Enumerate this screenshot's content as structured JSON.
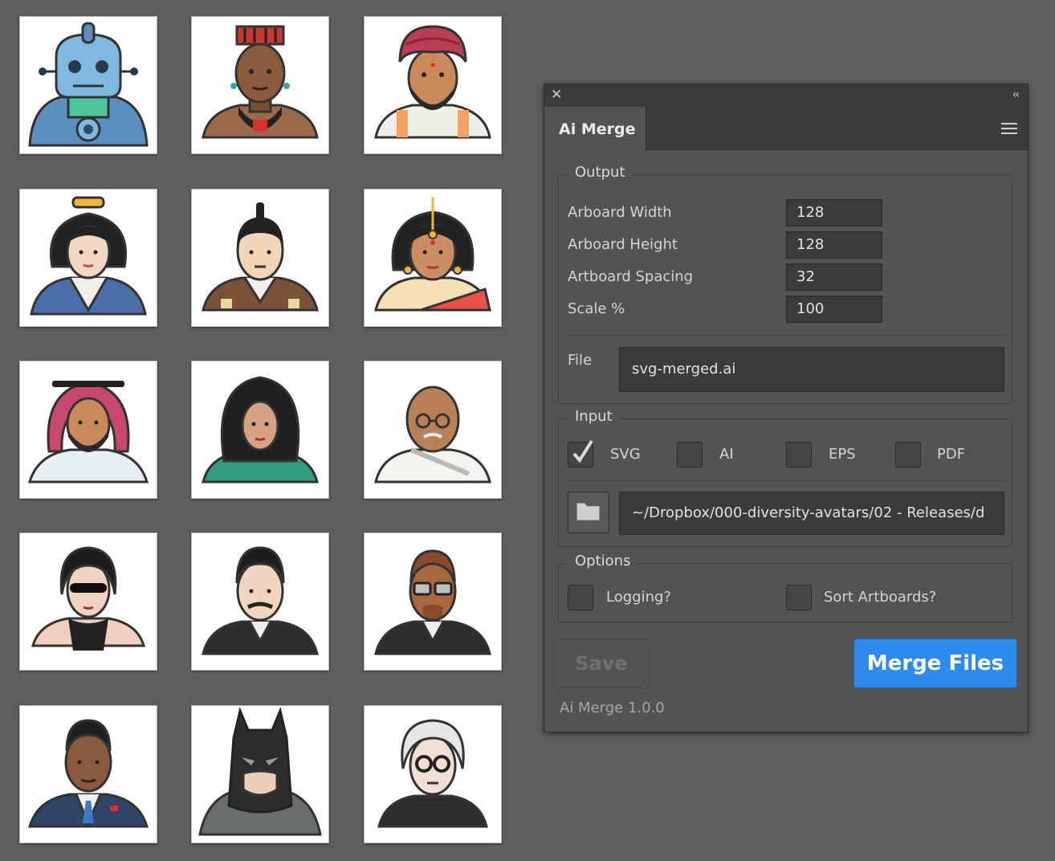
{
  "avatars": [
    {
      "name": "robot"
    },
    {
      "name": "african-man"
    },
    {
      "name": "turban-man"
    },
    {
      "name": "geisha"
    },
    {
      "name": "samurai"
    },
    {
      "name": "indian-woman"
    },
    {
      "name": "arab-man"
    },
    {
      "name": "hijab-woman"
    },
    {
      "name": "gandhi"
    },
    {
      "name": "trinity"
    },
    {
      "name": "tesla"
    },
    {
      "name": "malcolm-x"
    },
    {
      "name": "obama"
    },
    {
      "name": "batman"
    },
    {
      "name": "warhol"
    }
  ],
  "panel": {
    "close_icon": "close-icon",
    "collapse_icon": "double-chevron-left-icon",
    "tab_label": "Ai Merge",
    "menu_icon": "hamburger-menu-icon",
    "output": {
      "title": "Output",
      "fields": [
        {
          "label": "Arboard Width",
          "value": "128"
        },
        {
          "label": "Arboard Height",
          "value": "128"
        },
        {
          "label": "Artboard Spacing",
          "value": "32"
        },
        {
          "label": "Scale %",
          "value": "100"
        }
      ],
      "file_label": "File",
      "file_value": "svg-merged.ai"
    },
    "input": {
      "title": "Input",
      "formats": [
        {
          "label": "SVG",
          "checked": true
        },
        {
          "label": "AI",
          "checked": false
        },
        {
          "label": "EPS",
          "checked": false
        },
        {
          "label": "PDF",
          "checked": false
        }
      ],
      "folder_icon": "folder-icon",
      "path_value": "~/Dropbox/000-diversity-avatars/02 - Releases/d"
    },
    "options": {
      "title": "Options",
      "logging_label": "Logging?",
      "sort_label": "Sort Artboards?"
    },
    "save_label": "Save",
    "merge_label": "Merge Files",
    "version": "Ai Merge 1.0.0",
    "accent_color": "#2d8ceb"
  }
}
